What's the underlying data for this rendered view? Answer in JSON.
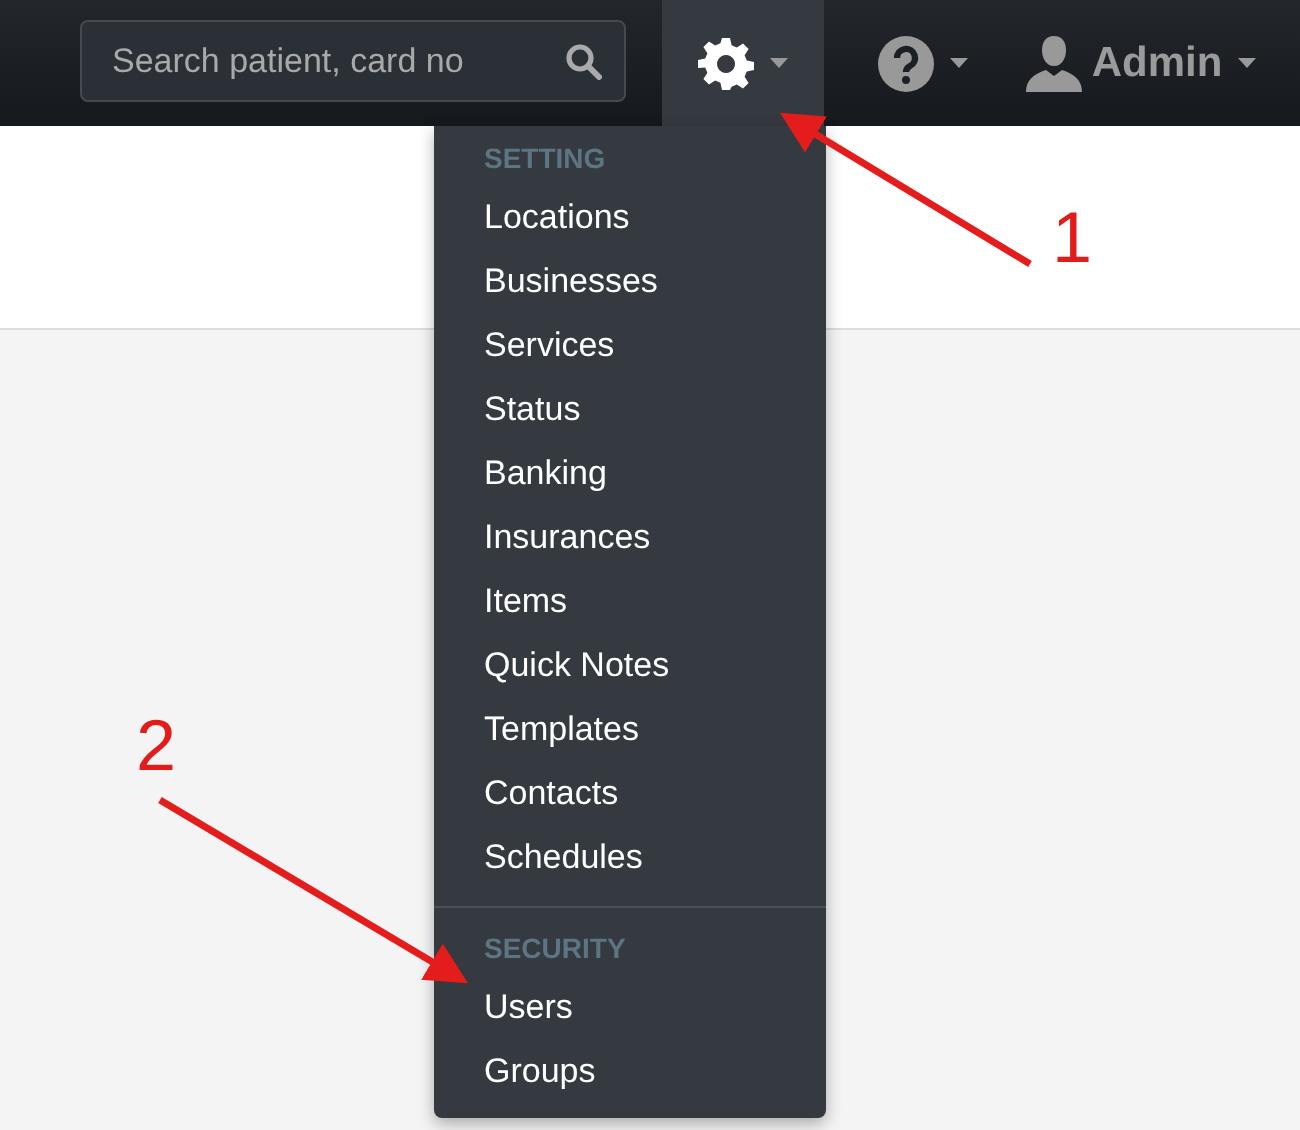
{
  "navbar": {
    "search": {
      "placeholder": "Search patient, card no"
    },
    "menus": [
      {
        "kind": "settings",
        "selected": true
      },
      {
        "kind": "help",
        "selected": false
      },
      {
        "kind": "user",
        "label": "Admin",
        "selected": false
      }
    ]
  },
  "dropdown": {
    "sections": [
      {
        "header": "SETTING",
        "items": [
          "Locations",
          "Businesses",
          "Services",
          "Status",
          "Banking",
          "Insurances",
          "Items",
          "Quick Notes",
          "Templates",
          "Contacts",
          "Schedules"
        ]
      },
      {
        "header": "SECURITY",
        "items": [
          "Users",
          "Groups"
        ]
      }
    ]
  },
  "annotations": [
    {
      "label": "1"
    },
    {
      "label": "2"
    }
  ]
}
